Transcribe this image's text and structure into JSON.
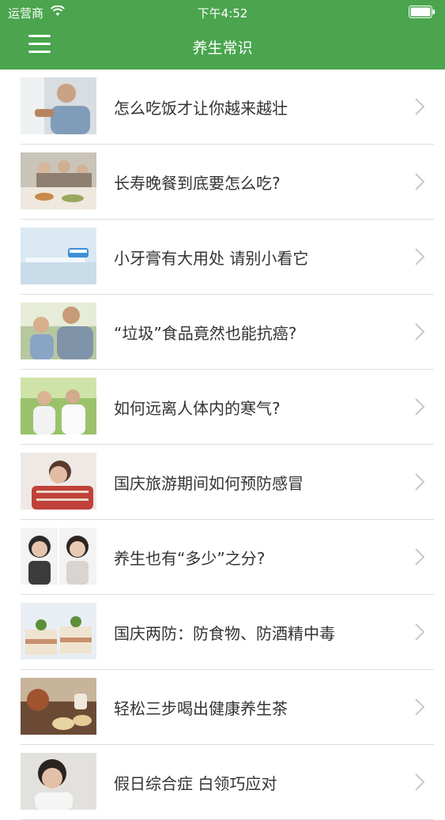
{
  "status_bar": {
    "carrier": "运营商",
    "time": "下午4:52"
  },
  "header": {
    "title": "养生常识"
  },
  "articles": [
    {
      "title": "怎么吃饭才让你越来越壮"
    },
    {
      "title": "长寿晚餐到底要怎么吃?"
    },
    {
      "title": "小牙膏有大用处 请别小看它"
    },
    {
      "title": "“垃圾”食品竟然也能抗癌?"
    },
    {
      "title": "如何远离人体内的寒气?"
    },
    {
      "title": "国庆旅游期间如何预防感冒"
    },
    {
      "title": "养生也有“多少”之分?"
    },
    {
      "title": "国庆两防：防食物、防酒精中毒"
    },
    {
      "title": "轻松三步喝出健康养生茶"
    },
    {
      "title": "假日综合症 白领巧应对"
    }
  ],
  "colors": {
    "accent": "#4aa54e"
  }
}
